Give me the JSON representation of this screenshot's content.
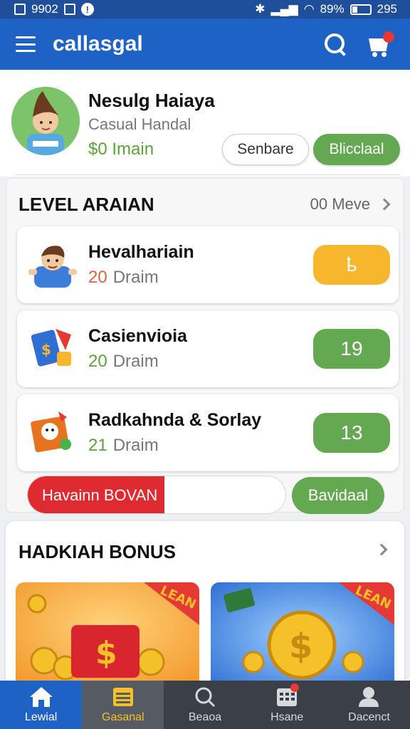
{
  "status_bar": {
    "time": "9902",
    "battery": "89%",
    "right_num": "295"
  },
  "app_bar": {
    "title": "callasgal"
  },
  "profile": {
    "name": "Nesulg Haiaya",
    "subtitle": "Casual Handal",
    "balance": "$0 Imain",
    "secondary_button": "Senbare",
    "primary_button": "Blicclaal"
  },
  "level": {
    "title": "LEVEL ARAIAN",
    "see_more": "00 Meve",
    "items": [
      {
        "name": "Hevalhariain",
        "count": "20",
        "unit": "Draim",
        "count_color": "#e0623a",
        "badge": "ҍ",
        "badge_color": "#f6b72e"
      },
      {
        "name": "Casienvioia",
        "count": "20",
        "unit": "Draim",
        "count_color": "#5aa339",
        "badge": "19",
        "badge_color": "#65a852"
      },
      {
        "name": "Radkahnda & Sorlay",
        "count": "21",
        "unit": "Draim",
        "count_color": "#5aa339",
        "badge": "13",
        "badge_color": "#65a852"
      }
    ],
    "progress": {
      "label": "Havainn BOVAN",
      "fraction": 0.53
    },
    "action_button": "Bavidaal"
  },
  "bonus": {
    "title": "HADKIAH BONUS",
    "cards": [
      {
        "ribbon": "LEAN"
      },
      {
        "ribbon": "LEAN"
      }
    ]
  },
  "nav": [
    {
      "label": "Lewial"
    },
    {
      "label": "Gasanal"
    },
    {
      "label": "Beaoa"
    },
    {
      "label": "Hsane"
    },
    {
      "label": "Dacenct"
    }
  ],
  "colors": {
    "primary": "#1f62c6",
    "green": "#65a852",
    "red": "#e02a32",
    "yellow": "#f6b72e"
  }
}
